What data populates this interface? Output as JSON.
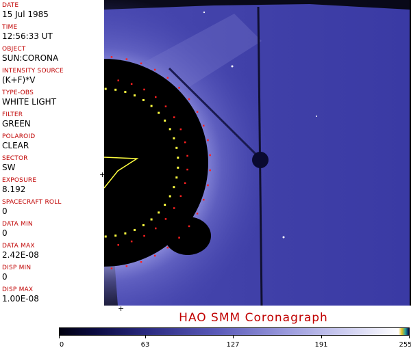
{
  "header": {
    "fields": [
      {
        "label": "DATE",
        "value": "15 Jul 1985"
      },
      {
        "label": "TIME",
        "value": "12:56:33 UT"
      },
      {
        "label": "OBJECT",
        "value": "SUN:CORONA"
      },
      {
        "label": "INTENSITY SOURCE",
        "value": "(K+F)*V"
      },
      {
        "label": "TYPE-OBS",
        "value": "WHITE LIGHT"
      },
      {
        "label": "FILTER",
        "value": "GREEN"
      },
      {
        "label": "POLAROID",
        "value": "CLEAR"
      },
      {
        "label": "SECTOR",
        "value": "SW"
      },
      {
        "label": "EXPOSURE",
        "value": "8.192"
      },
      {
        "label": "SPACECRAFT ROLL",
        "value": "0"
      },
      {
        "label": "DATA MIN",
        "value": "0"
      },
      {
        "label": "DATA MAX",
        "value": "2.42E-08"
      },
      {
        "label": "DISP MIN",
        "value": "0"
      },
      {
        "label": "DISP MAX",
        "value": "1.00E-08"
      }
    ]
  },
  "caption": "HAO  SMM Coronagraph",
  "colorbar": {
    "ticks": [
      "0",
      "63",
      "127",
      "191",
      "255"
    ],
    "tick_values": [
      0,
      63,
      127,
      191,
      255
    ],
    "max": 255
  },
  "colors": {
    "label": "#c00000",
    "corona_blue": "#4a4ab8",
    "occulter": "#000000",
    "marker_red": "#ff2020",
    "marker_yellow": "#ffff40"
  }
}
